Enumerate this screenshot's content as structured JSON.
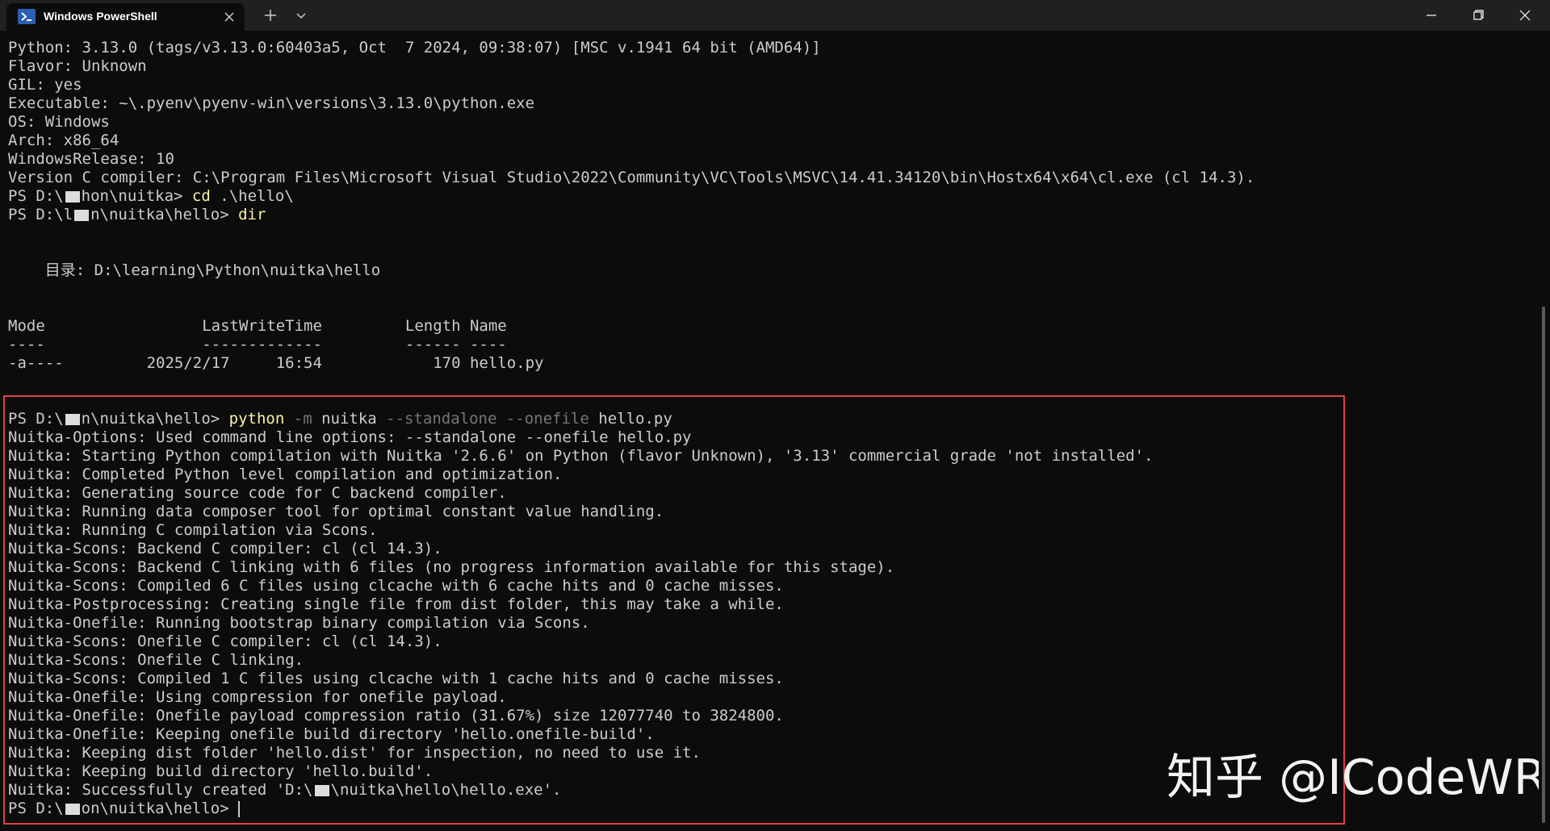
{
  "window": {
    "tab_title": "Windows PowerShell"
  },
  "terminal": {
    "lines": [
      {
        "parts": [
          {
            "t": "Python: 3.13.0 (tags/v3.13.0:60403a5, Oct  7 2024, 09:38:07) [MSC v.1941 64 bit (AMD64)]"
          }
        ]
      },
      {
        "parts": [
          {
            "t": "Flavor: Unknown"
          }
        ]
      },
      {
        "parts": [
          {
            "t": "GIL: yes"
          }
        ]
      },
      {
        "parts": [
          {
            "t": "Executable: ~\\.pyenv\\pyenv-win\\versions\\3.13.0\\python.exe"
          }
        ]
      },
      {
        "parts": [
          {
            "t": "OS: Windows"
          }
        ]
      },
      {
        "parts": [
          {
            "t": "Arch: x86_64"
          }
        ]
      },
      {
        "parts": [
          {
            "t": "WindowsRelease: 10"
          }
        ]
      },
      {
        "parts": [
          {
            "t": "Version C compiler: C:\\Program Files\\Microsoft Visual Studio\\2022\\Community\\VC\\Tools\\MSVC\\14.41.34120\\bin\\Hostx64\\x64\\cl.exe (cl 14.3)."
          }
        ]
      },
      {
        "parts": [
          {
            "t": "PS D:\\"
          },
          {
            "redact": true
          },
          {
            "t": "hon\\nuitka> "
          },
          {
            "t": "cd",
            "c": "cmd"
          },
          {
            "t": " .\\hello\\"
          }
        ]
      },
      {
        "parts": [
          {
            "t": "PS D:\\l"
          },
          {
            "redact": true
          },
          {
            "t": "n\\nuitka\\hello> "
          },
          {
            "t": "dir",
            "c": "cmd"
          }
        ]
      },
      {
        "parts": [
          {
            "t": ""
          }
        ]
      },
      {
        "parts": [
          {
            "t": ""
          }
        ]
      },
      {
        "parts": [
          {
            "t": "    目录: D:\\learning\\Python\\nuitka\\hello"
          }
        ]
      },
      {
        "parts": [
          {
            "t": ""
          }
        ]
      },
      {
        "parts": [
          {
            "t": ""
          }
        ]
      },
      {
        "parts": [
          {
            "t": "Mode                 LastWriteTime         Length Name"
          }
        ]
      },
      {
        "parts": [
          {
            "t": "----                 -------------         ------ ----"
          }
        ]
      },
      {
        "parts": [
          {
            "t": "-a----         2025/2/17     16:54            170 hello.py"
          }
        ]
      },
      {
        "parts": [
          {
            "t": ""
          }
        ]
      },
      {
        "parts": [
          {
            "t": ""
          }
        ]
      },
      {
        "parts": [
          {
            "t": "PS D:\\"
          },
          {
            "redact": true
          },
          {
            "t": "n\\nuitka\\hello> "
          },
          {
            "t": "python",
            "c": "cmd"
          },
          {
            "t": " -m",
            "c": "param"
          },
          {
            "t": " nuitka "
          },
          {
            "t": "--standalone --onefile",
            "c": "param"
          },
          {
            "t": " hello.py"
          }
        ]
      },
      {
        "parts": [
          {
            "t": "Nuitka-Options: Used command line options: --standalone --onefile hello.py"
          }
        ]
      },
      {
        "parts": [
          {
            "t": "Nuitka: Starting Python compilation with Nuitka '2.6.6' on Python (flavor Unknown), '3.13' commercial grade 'not installed'."
          }
        ]
      },
      {
        "parts": [
          {
            "t": "Nuitka: Completed Python level compilation and optimization."
          }
        ]
      },
      {
        "parts": [
          {
            "t": "Nuitka: Generating source code for C backend compiler."
          }
        ]
      },
      {
        "parts": [
          {
            "t": "Nuitka: Running data composer tool for optimal constant value handling."
          }
        ]
      },
      {
        "parts": [
          {
            "t": "Nuitka: Running C compilation via Scons."
          }
        ]
      },
      {
        "parts": [
          {
            "t": "Nuitka-Scons: Backend C compiler: cl (cl 14.3)."
          }
        ]
      },
      {
        "parts": [
          {
            "t": "Nuitka-Scons: Backend C linking with 6 files (no progress information available for this stage)."
          }
        ]
      },
      {
        "parts": [
          {
            "t": "Nuitka-Scons: Compiled 6 C files using clcache with 6 cache hits and 0 cache misses."
          }
        ]
      },
      {
        "parts": [
          {
            "t": "Nuitka-Postprocessing: Creating single file from dist folder, this may take a while."
          }
        ]
      },
      {
        "parts": [
          {
            "t": "Nuitka-Onefile: Running bootstrap binary compilation via Scons."
          }
        ]
      },
      {
        "parts": [
          {
            "t": "Nuitka-Scons: Onefile C compiler: cl (cl 14.3)."
          }
        ]
      },
      {
        "parts": [
          {
            "t": "Nuitka-Scons: Onefile C linking."
          }
        ]
      },
      {
        "parts": [
          {
            "t": "Nuitka-Scons: Compiled 1 C files using clcache with 1 cache hits and 0 cache misses."
          }
        ]
      },
      {
        "parts": [
          {
            "t": "Nuitka-Onefile: Using compression for onefile payload."
          }
        ]
      },
      {
        "parts": [
          {
            "t": "Nuitka-Onefile: Onefile payload compression ratio (31.67%) size 12077740 to 3824800."
          }
        ]
      },
      {
        "parts": [
          {
            "t": "Nuitka-Onefile: Keeping onefile build directory 'hello.onefile-build'."
          }
        ]
      },
      {
        "parts": [
          {
            "t": "Nuitka: Keeping dist folder 'hello.dist' for inspection, no need to use it."
          }
        ]
      },
      {
        "parts": [
          {
            "t": "Nuitka: Keeping build directory 'hello.build'."
          }
        ]
      },
      {
        "parts": [
          {
            "t": "Nuitka: Successfully created 'D:\\"
          },
          {
            "redact": true
          },
          {
            "t": "\\nuitka\\hello\\hello.exe'."
          }
        ]
      },
      {
        "parts": [
          {
            "t": "PS D:\\"
          },
          {
            "redact": true
          },
          {
            "t": "on\\nuitka\\hello> "
          },
          {
            "cursor": true
          }
        ]
      }
    ]
  },
  "watermark": "知乎 @ICodeWR",
  "colors": {
    "background": "#0c0c0c",
    "foreground": "#cccccc",
    "command": "#f9f1a5",
    "parameter": "#767676",
    "highlight_border": "#e0404a"
  }
}
